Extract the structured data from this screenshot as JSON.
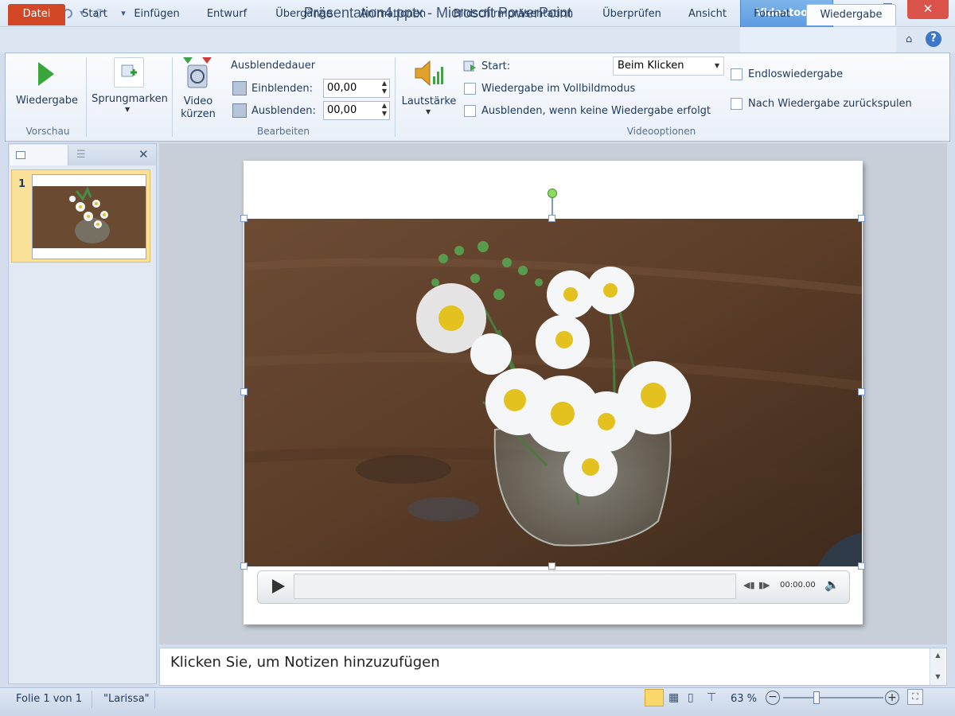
{
  "window": {
    "title": "Präsentation4.pptx - Microsoft PowerPoint",
    "contextual_tab_group": "Videotools",
    "minimize_icon": "minimize-icon",
    "maximize_icon": "maximize-icon",
    "close_icon": "close-icon"
  },
  "quick_access": {
    "app_icon_letter": "P",
    "save_icon": "save-icon",
    "undo_icon": "undo-icon",
    "redo_icon": "redo-icon",
    "customize_icon": "customize-arrow-icon"
  },
  "tabs": [
    {
      "label": "Datei"
    },
    {
      "label": "Start"
    },
    {
      "label": "Einfügen"
    },
    {
      "label": "Entwurf"
    },
    {
      "label": "Übergänge"
    },
    {
      "label": "Animationen"
    },
    {
      "label": "Bildschirmpräsentation"
    },
    {
      "label": "Überprüfen"
    },
    {
      "label": "Ansicht"
    },
    {
      "label": "Format"
    },
    {
      "label": "Wiedergabe"
    }
  ],
  "active_tab": "Wiedergabe",
  "ribbon": {
    "preview": {
      "button_label": "Wiedergabe",
      "group_label": "Vorschau"
    },
    "bookmarks": {
      "button_label": "Sprungmarken"
    },
    "edit": {
      "trim_label_line1": "Video",
      "trim_label_line2": "kürzen",
      "fade_duration_label": "Ausblendedauer",
      "fade_in_label": "Einblenden:",
      "fade_in_value": "00,00",
      "fade_out_label": "Ausblenden:",
      "fade_out_value": "00,00",
      "group_label": "Bearbeiten"
    },
    "video_options": {
      "volume_label": "Lautstärke",
      "start_label": "Start:",
      "start_value": "Beim Klicken",
      "fullscreen_label": "Wiedergabe im Vollbildmodus",
      "fullscreen_checked": false,
      "hide_label": "Ausblenden, wenn keine Wiedergabe erfolgt",
      "hide_checked": false,
      "loop_label": "Endloswiedergabe",
      "loop_checked": false,
      "rewind_label": "Nach Wiedergabe zurückspulen",
      "rewind_checked": false,
      "group_label": "Videooptionen"
    }
  },
  "slides_panel": {
    "slide_number": "1"
  },
  "video_player": {
    "time": "00:00.00",
    "play_icon": "play-icon"
  },
  "notes": {
    "placeholder": "Klicken Sie, um Notizen hinzuzufügen"
  },
  "statusbar": {
    "slide_info": "Folie 1 von 1",
    "theme": "\"Larissa\"",
    "zoom": "63 %",
    "zoom_level_fraction": 0.63
  },
  "colors": {
    "accent_file_tab": "#d24726",
    "contextual_blue": "#5d9be0",
    "ribbon_bg": "#fbfcfe"
  }
}
